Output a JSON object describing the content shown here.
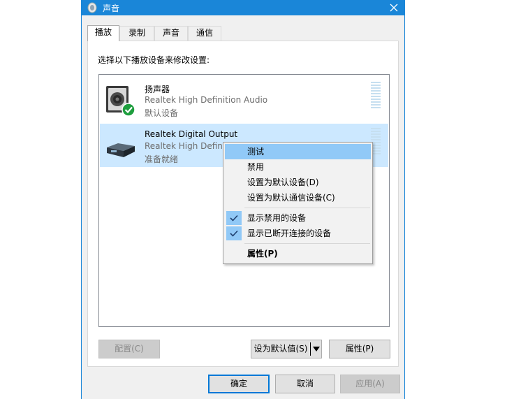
{
  "window": {
    "title": "声音",
    "close_icon": "close-icon",
    "accent_color": "#1a86d8"
  },
  "tabs": [
    {
      "label": "播放",
      "active": true
    },
    {
      "label": "录制",
      "active": false
    },
    {
      "label": "声音",
      "active": false
    },
    {
      "label": "通信",
      "active": false
    }
  ],
  "panel": {
    "instruction": "选择以下播放设备来修改设置:"
  },
  "devices": [
    {
      "name": "扬声器",
      "driver": "Realtek High Definition Audio",
      "status": "默认设备",
      "icon": "speaker-icon",
      "default_badge": "check-badge-icon"
    },
    {
      "name": "Realtek Digital Output",
      "driver": "Realtek High Definition Audio",
      "status": "准备就绪",
      "icon": "digital-output-icon",
      "selected": true
    }
  ],
  "context_menu": {
    "items": [
      {
        "label": "测试"
      },
      {
        "label": "禁用"
      },
      {
        "label": "设置为默认设备(D)"
      },
      {
        "label": "设置为默认通信设备(C)"
      },
      {
        "label": "显示禁用的设备",
        "checked": true
      },
      {
        "label": "显示已断开连接的设备",
        "checked": true
      },
      {
        "label": "属性(P)"
      }
    ]
  },
  "panel_buttons": {
    "configure": "配置(C)",
    "set_default": "设为默认值(S)",
    "properties": "属性(P)"
  },
  "dialog_buttons": {
    "ok": "确定",
    "cancel": "取消",
    "apply": "应用(A)"
  }
}
